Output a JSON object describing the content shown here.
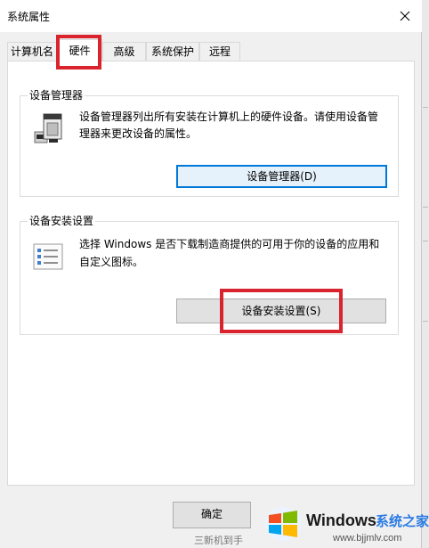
{
  "window": {
    "title": "系统属性",
    "close_icon": "close-icon"
  },
  "tabs": [
    {
      "label": "计算机名",
      "active": false
    },
    {
      "label": "硬件",
      "active": true
    },
    {
      "label": "高级",
      "active": false
    },
    {
      "label": "系统保护",
      "active": false
    },
    {
      "label": "远程",
      "active": false
    }
  ],
  "device_manager": {
    "title": "设备管理器",
    "description_line1": "设备管理器列出所有安装在计算机上的硬件设备。请使用设备管",
    "description_line2": "理器来更改设备的属性。",
    "button_label": "设备管理器(D)",
    "icon": "device-manager-icon"
  },
  "device_install": {
    "title": "设备安装设置",
    "description_line1": "选择 Windows 是否下载制造商提供的可用于你的设备的应用和",
    "description_line2": "自定义图标。",
    "button_label": "设备安装设置(S)",
    "icon": "checklist-icon"
  },
  "footer": {
    "ok_label": "确定",
    "partial_text": "三新机到手"
  },
  "watermark": {
    "brand": "Windows",
    "site_name": "系统之家",
    "url": "www.bjjmlv.com"
  },
  "colors": {
    "highlight": "#d9232d",
    "focus": "#0078d7",
    "panel_bg": "#ffffff",
    "window_bg": "#f0f0f0"
  }
}
